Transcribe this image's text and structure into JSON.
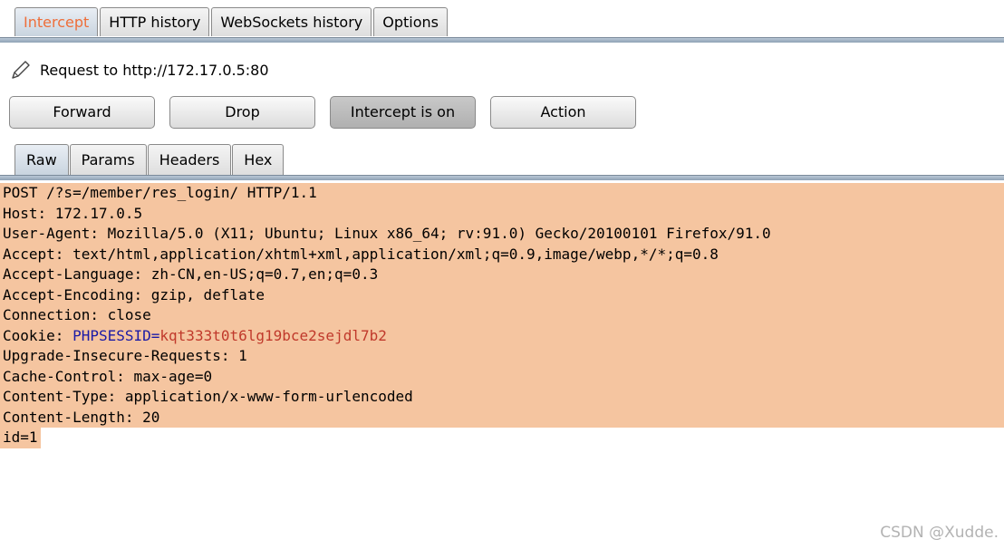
{
  "top_tabs": {
    "intercept": "Intercept",
    "http_history": "HTTP history",
    "websockets_history": "WebSockets history",
    "options": "Options"
  },
  "request": {
    "label": "Request to http://172.17.0.5:80",
    "icon": "pencil-icon"
  },
  "buttons": {
    "forward": "Forward",
    "drop": "Drop",
    "intercept_toggle": "Intercept is on",
    "action": "Action"
  },
  "sub_tabs": {
    "raw": "Raw",
    "params": "Params",
    "headers": "Headers",
    "hex": "Hex"
  },
  "raw_request": {
    "lines": [
      "POST /?s=/member/res_login/ HTTP/1.1",
      "Host: 172.17.0.5",
      "User-Agent: Mozilla/5.0 (X11; Ubuntu; Linux x86_64; rv:91.0) Gecko/20100101 Firefox/91.0",
      "Accept: text/html,application/xhtml+xml,application/xml;q=0.9,image/webp,*/*;q=0.8",
      "Accept-Language: zh-CN,en-US;q=0.7,en;q=0.3",
      "Accept-Encoding: gzip, deflate",
      "Connection: close"
    ],
    "cookie_prefix": "Cookie: ",
    "cookie_name": "PHPSESSID",
    "cookie_eq": "=",
    "cookie_value": "kqt333t0t6lg19bce2sejdl7b2",
    "lines_after": [
      "Upgrade-Insecure-Requests: 1",
      "Cache-Control: max-age=0",
      "Content-Type: application/x-www-form-urlencoded",
      "Content-Length: 20"
    ],
    "body": "id=1"
  },
  "watermark": "CSDN @Xudde.",
  "colors": {
    "active_tab_text": "#ee6e3a",
    "highlight": "#f5c5a0",
    "cookie_name": "#1a1aa6",
    "cookie_value": "#c0392b"
  }
}
